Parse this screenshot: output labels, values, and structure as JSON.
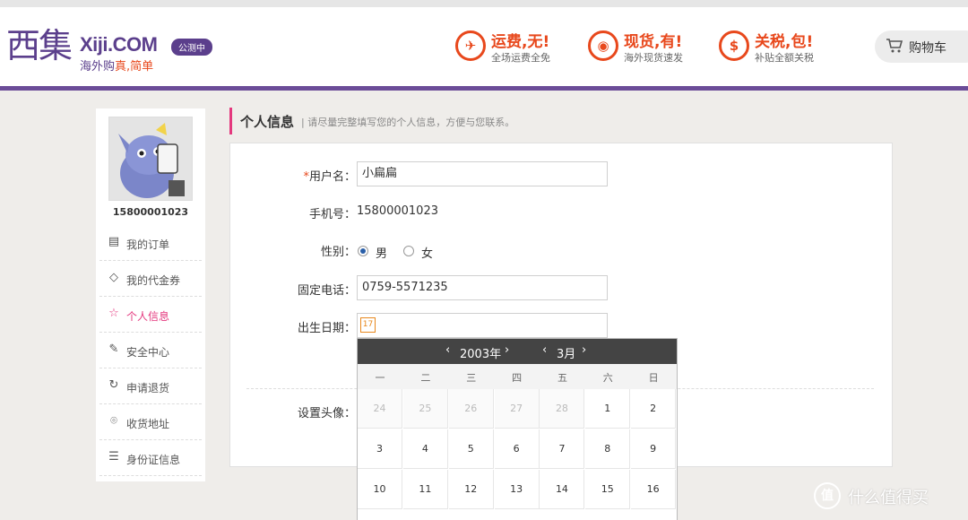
{
  "header": {
    "logo_glyph": "西集",
    "logo_domain": "Xiji.COM",
    "logo_badge": "公测中",
    "logo_slogan_a": "海外购",
    "logo_slogan_b": "真,简单",
    "promos": [
      {
        "icon": "plane-icon",
        "glyph": "✈",
        "title": "运费,无!",
        "sub": "全场运费全免"
      },
      {
        "icon": "map-pin-icon",
        "glyph": "◉",
        "title": "现货,有!",
        "sub": "海外现货速发"
      },
      {
        "icon": "dollar-icon",
        "glyph": "$",
        "title": "关税,包!",
        "sub": "补贴全额关税"
      }
    ],
    "cart_label": "购物车"
  },
  "sidebar": {
    "user_id": "15800001023",
    "items": [
      {
        "label": "我的订单",
        "glyph": "▤"
      },
      {
        "label": "我的代金券",
        "glyph": "◇"
      },
      {
        "label": "个人信息",
        "glyph": "☆"
      },
      {
        "label": "安全中心",
        "glyph": "✎"
      },
      {
        "label": "申请退货",
        "glyph": "↻"
      },
      {
        "label": "收货地址",
        "glyph": "⌾"
      },
      {
        "label": "身份证信息",
        "glyph": "☰"
      }
    ]
  },
  "section": {
    "title": "个人信息",
    "subtitle": "| 请尽量完整填写您的个人信息，方便与您联系。"
  },
  "form": {
    "username_label": "用户名：",
    "username_value": "小扁扁",
    "mobile_label": "手机号：",
    "mobile_value": "15800001023",
    "gender_label": "性别：",
    "gender_male": "男",
    "gender_female": "女",
    "gender_selected": "男",
    "landline_label": "固定电话：",
    "landline_value": "0759-5571235",
    "birthday_label": "出生日期：",
    "birthday_value": "",
    "calendar_icon_text": "17",
    "avatar_label": "设置头像："
  },
  "calendar": {
    "year": "2003年",
    "month": "3月",
    "weekdays": [
      "一",
      "二",
      "三",
      "四",
      "五",
      "六",
      "日"
    ],
    "prev_month_days": [
      "24",
      "25",
      "26",
      "27",
      "28"
    ],
    "days": [
      "1",
      "2",
      "3",
      "4",
      "5",
      "6",
      "7",
      "8",
      "9",
      "10",
      "11",
      "12",
      "13",
      "14",
      "15",
      "16"
    ]
  },
  "watermark": {
    "glyph": "值",
    "text": "什么值得买"
  },
  "colors": {
    "brand_purple": "#5b3f8c",
    "accent_orange": "#e8481c",
    "active_pink": "#e4387e"
  }
}
